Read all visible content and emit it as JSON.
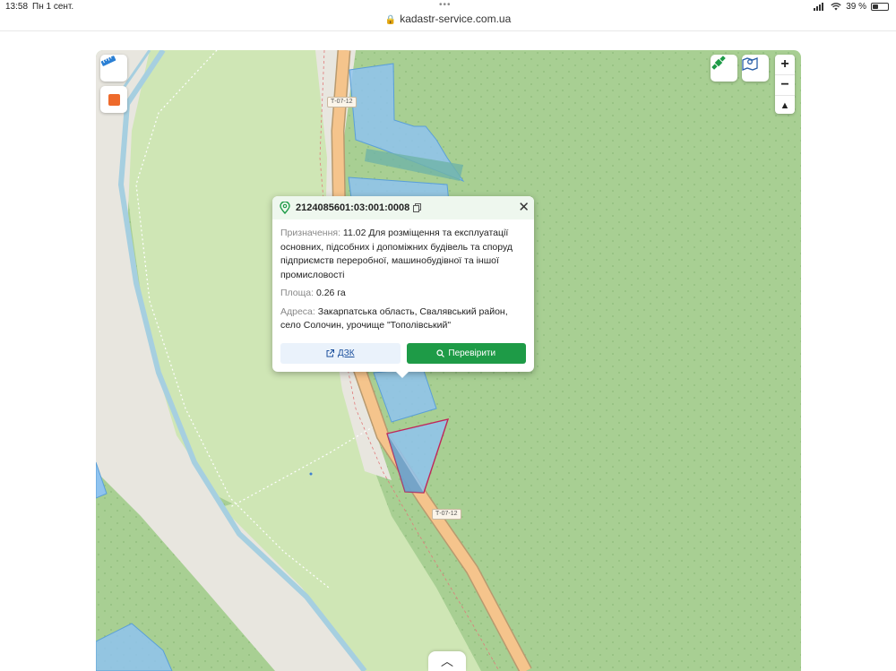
{
  "statusbar": {
    "time": "13:58",
    "date": "Пн 1 сент.",
    "battery": "39 %",
    "battery_level": 0.39
  },
  "browser": {
    "url": "kadastr-service.com.ua"
  },
  "map": {
    "road_label_top": "Т-07-12",
    "road_label_bottom": "Т-07-12",
    "colors": {
      "forest": "#a8cf93",
      "meadow": "#cfe6b5",
      "road": "#f5c48c",
      "river": "#a6cfe0",
      "parcel": "#8fc3ef",
      "parcel_selected_border": "#c0265a",
      "accent_green": "#1e9b47",
      "accent_orange": "#ee6a2b"
    }
  },
  "controls": {
    "ruler_icon": "ruler-icon",
    "square_icon": "orange-square-icon",
    "layer_icon": "satellite-icon",
    "map_icon": "map-pin-icon",
    "zoom_in": "+",
    "zoom_out": "−",
    "compass": "▲"
  },
  "popup": {
    "cadastral_number": "2124085601:03:001:0008",
    "purpose_label": "Призначення:",
    "purpose_value": "11.02 Для розміщення та експлуатації основних, підсобних і допоміжних будівель та споруд підприємств переробної, машинобудівної та іншої промисловості",
    "area_label": "Площа:",
    "area_value": "0.26 га",
    "address_label": "Адреса:",
    "address_value": "Закарпатська область, Свалявський район, село Солочин, урочище \"Тополівський\"",
    "dzk_button": "ДЗК",
    "check_button": "Перевірити",
    "close": "✕"
  },
  "bottom": {
    "expand_icon": "︿"
  }
}
